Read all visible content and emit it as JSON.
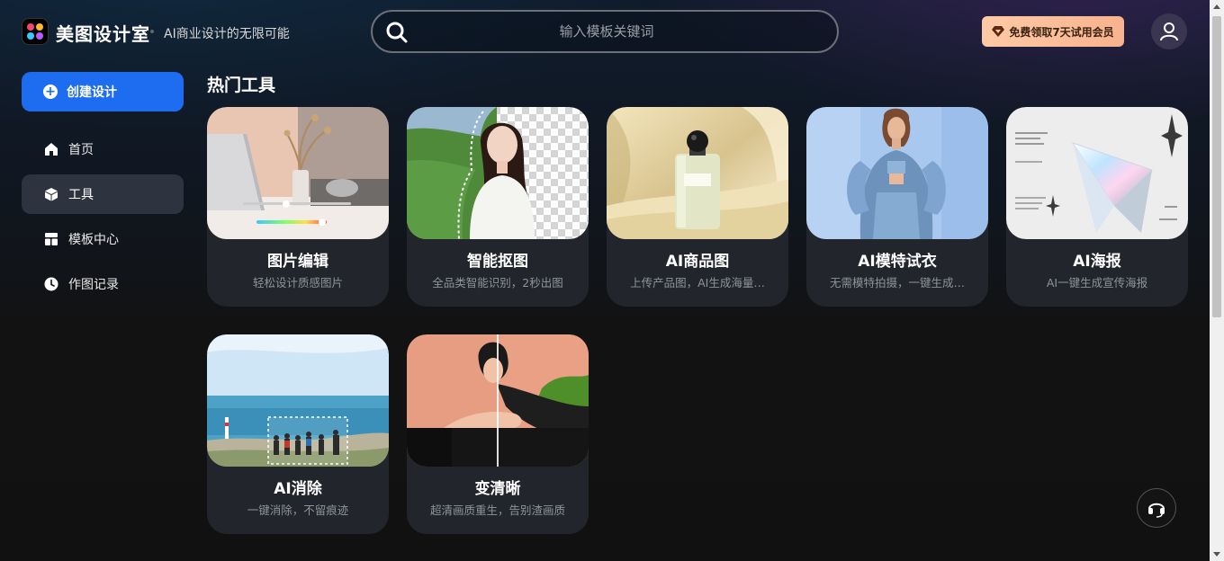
{
  "header": {
    "brand": "美图设计室",
    "slogan": "AI商业设计的无限可能",
    "search_placeholder": "输入模板关键词",
    "vip_label": "免费领取7天试用会员"
  },
  "sidebar": {
    "create_label": "创建设计",
    "items": [
      {
        "label": "首页",
        "icon": "home-icon"
      },
      {
        "label": "工具",
        "icon": "cube-icon"
      },
      {
        "label": "模板中心",
        "icon": "layout-icon"
      },
      {
        "label": "作图记录",
        "icon": "clock-icon"
      }
    ],
    "active_index": 1
  },
  "main": {
    "section_title": "热门工具",
    "tools": [
      {
        "title": "图片编辑",
        "desc": "轻松设计质感图片"
      },
      {
        "title": "智能抠图",
        "desc": "全品类智能识别，2秒出图"
      },
      {
        "title": "AI商品图",
        "desc": "上传产品图，AI生成海量…"
      },
      {
        "title": "AI模特试衣",
        "desc": "无需模特拍摄，一键生成…"
      },
      {
        "title": "AI海报",
        "desc": "AI一键生成宣传海报"
      },
      {
        "title": "AI消除",
        "desc": "一键消除，不留痕迹"
      },
      {
        "title": "变清晰",
        "desc": "超清画质重生，告别渣画质"
      }
    ]
  },
  "colors": {
    "accent": "#1e6cf0",
    "vip_gradient_start": "#ffc9a6",
    "vip_gradient_end": "#f7b38d",
    "card_bg": "#22252c"
  }
}
